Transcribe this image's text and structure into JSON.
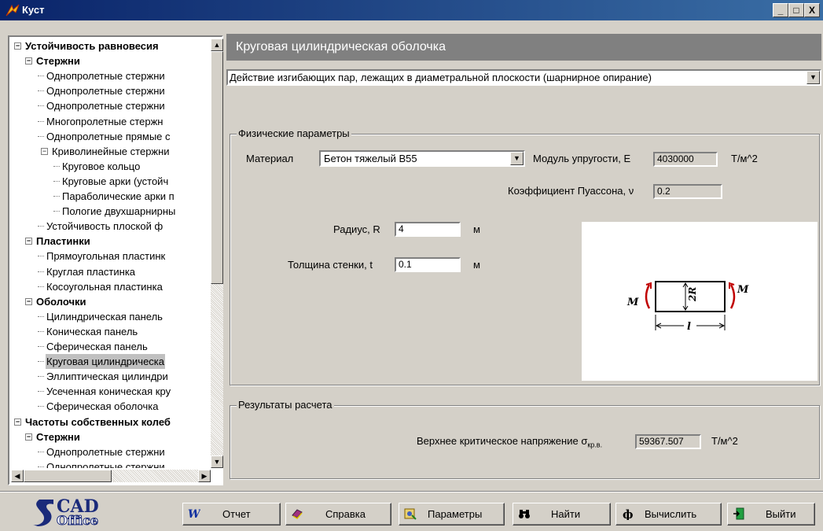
{
  "window": {
    "title": "Куст",
    "minimize": "_",
    "maximize": "□",
    "close": "X"
  },
  "tree": {
    "items": [
      {
        "label": "Устойчивость равновесия",
        "level": 0,
        "bold": true,
        "expander": "-"
      },
      {
        "label": "Стержни",
        "level": 1,
        "bold": true,
        "expander": "-"
      },
      {
        "label": "Однопролетные стержни",
        "level": 2
      },
      {
        "label": "Однопролетные стержни",
        "level": 2
      },
      {
        "label": "Однопролетные стержни",
        "level": 2
      },
      {
        "label": "Многопролетные стержн",
        "level": 2
      },
      {
        "label": "Однопролетные прямые с",
        "level": 2
      },
      {
        "label": "Криволинейные стержни",
        "level": 2,
        "expander": "-"
      },
      {
        "label": "Круговое кольцо",
        "level": 3
      },
      {
        "label": "Круговые арки (устойч",
        "level": 3
      },
      {
        "label": "Параболические арки п",
        "level": 3
      },
      {
        "label": "Пологие двухшарнирны",
        "level": 3
      },
      {
        "label": "Устойчивость плоской ф",
        "level": 2
      },
      {
        "label": "Пластинки",
        "level": 1,
        "bold": true,
        "expander": "-"
      },
      {
        "label": "Прямоугольная пластинк",
        "level": 2
      },
      {
        "label": "Круглая пластинка",
        "level": 2
      },
      {
        "label": "Косоугольная пластинка",
        "level": 2
      },
      {
        "label": "Оболочки",
        "level": 1,
        "bold": true,
        "expander": "-"
      },
      {
        "label": "Цилиндрическая панель",
        "level": 2
      },
      {
        "label": "Коническая панель",
        "level": 2
      },
      {
        "label": "Сферическая панель",
        "level": 2
      },
      {
        "label": "Круговая цилиндрическа",
        "level": 2,
        "selected": true
      },
      {
        "label": "Эллиптическая цилиндри",
        "level": 2
      },
      {
        "label": "Усеченная коническая кру",
        "level": 2
      },
      {
        "label": "Сферическая оболочка",
        "level": 2
      },
      {
        "label": "Частоты собственных колеб",
        "level": 0,
        "bold": true,
        "expander": "-"
      },
      {
        "label": "Стержни",
        "level": 1,
        "bold": true,
        "expander": "-"
      },
      {
        "label": "Однопролетные стержни",
        "level": 2
      },
      {
        "label": "Однопролетные стержни",
        "level": 2
      }
    ]
  },
  "main": {
    "title": "Круговая цилиндрическая оболочка",
    "mode": "Действие изгибающих пар, лежащих в диаметральной плоскости (шарнирное опирание)",
    "physical": {
      "group_title": "Физические параметры",
      "material_label": "Материал",
      "material_value": "Бетон тяжелый В55",
      "modulus_label": "Модуль упругости, E",
      "modulus_value": "4030000",
      "modulus_unit": "Т/м^2",
      "poisson_label": "Коэффициент Пуассона, ν",
      "poisson_value": "0.2",
      "radius_label": "Радиус, R",
      "radius_value": "4",
      "radius_unit": "м",
      "thickness_label": "Толщина стенки, t",
      "thickness_value": "0.1",
      "thickness_unit": "м"
    },
    "diagram": {
      "moment_left": "M",
      "moment_right": "M",
      "diameter": "2R",
      "length": "l"
    },
    "results": {
      "group_title": "Результаты расчета",
      "stress_label": "Верхнее критическое напряжение σ",
      "stress_sub": "кр.в.",
      "stress_value": "59367.507",
      "stress_unit": "Т/м^2"
    }
  },
  "toolbar": {
    "logo_top": "CAD",
    "logo_bottom": "Office",
    "report": "Отчет",
    "help": "Справка",
    "params": "Параметры",
    "find": "Найти",
    "calculate": "Вычислить",
    "exit": "Выйти"
  }
}
